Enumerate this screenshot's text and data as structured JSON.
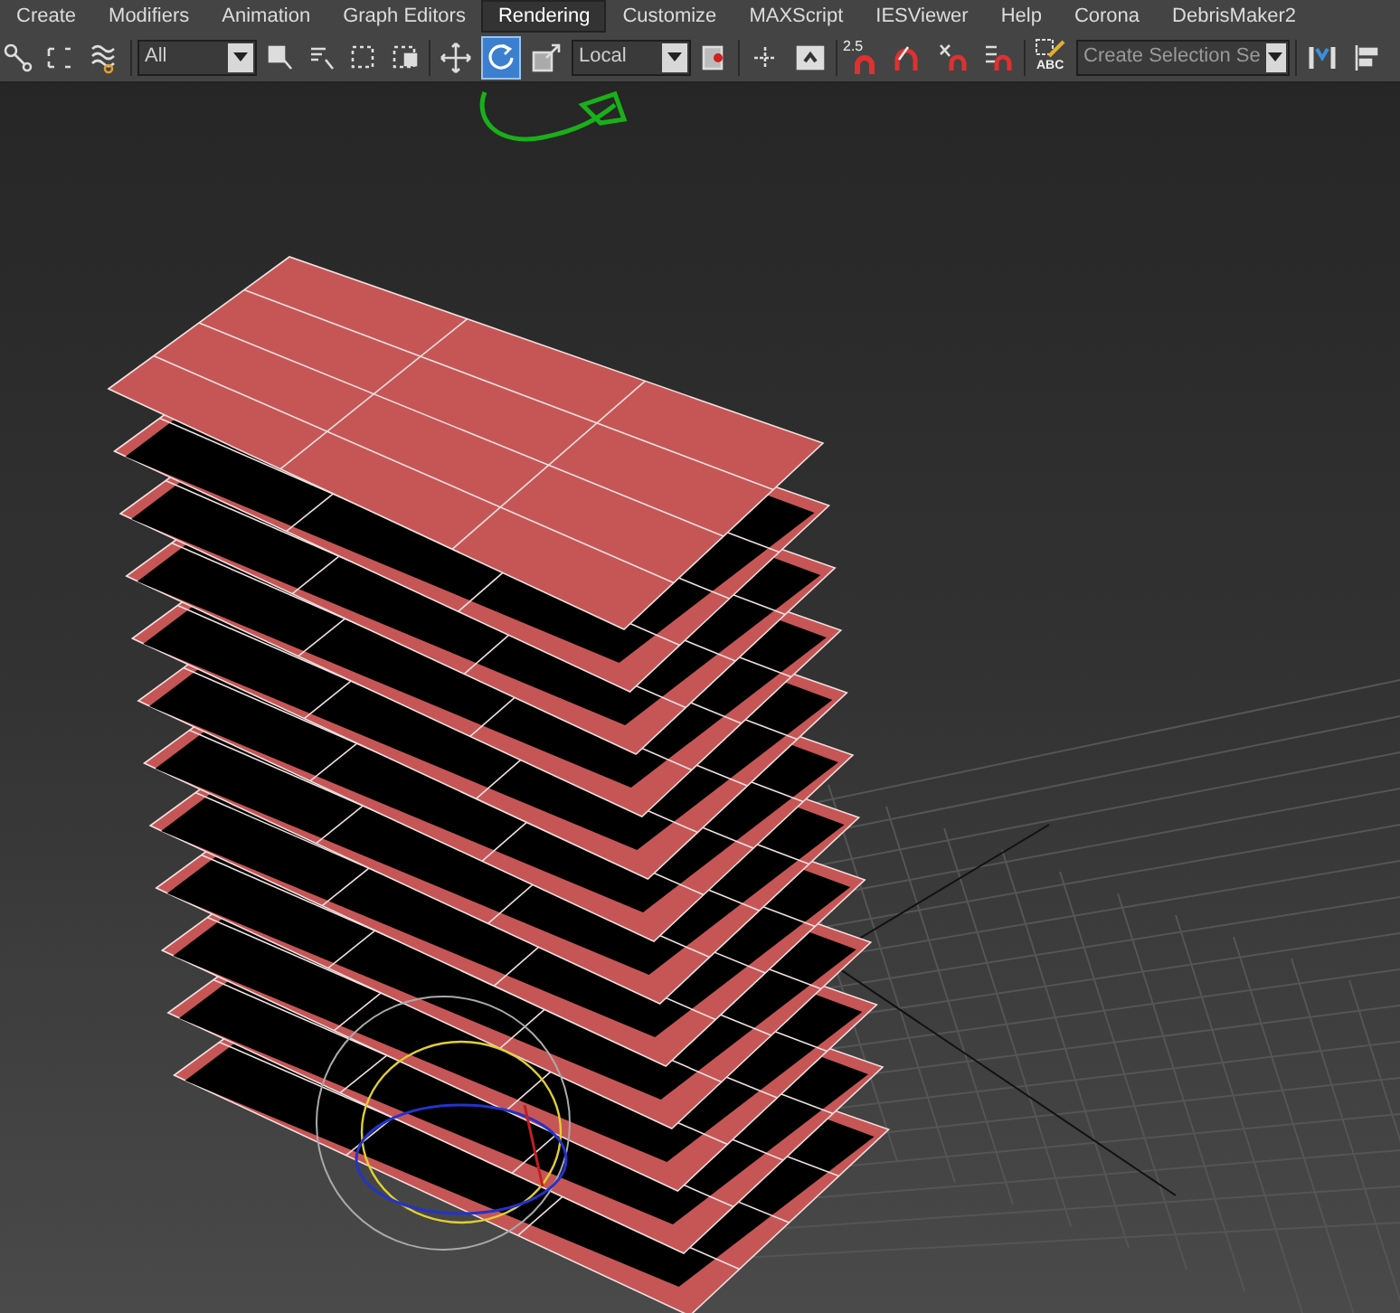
{
  "menu": [
    {
      "label": "Create",
      "selected": false
    },
    {
      "label": "Modifiers",
      "selected": false
    },
    {
      "label": "Animation",
      "selected": false
    },
    {
      "label": "Graph Editors",
      "selected": false
    },
    {
      "label": "Rendering",
      "selected": true
    },
    {
      "label": "Customize",
      "selected": false
    },
    {
      "label": "MAXScript",
      "selected": false
    },
    {
      "label": "IESViewer",
      "selected": false
    },
    {
      "label": "Help",
      "selected": false
    },
    {
      "label": "Corona",
      "selected": false
    },
    {
      "label": "DebrisMaker2",
      "selected": false
    }
  ],
  "toolbar": {
    "selection_filter": "All",
    "reference_coordinate": "Local",
    "angle_snap_label": "2.5",
    "named_selection_icon_label": "ABC",
    "named_selection_placeholder": "Create Selection Se",
    "tools": [
      {
        "kind": "move",
        "selected": false
      },
      {
        "kind": "rotate",
        "selected": true
      },
      {
        "kind": "scale",
        "selected": false
      }
    ]
  }
}
